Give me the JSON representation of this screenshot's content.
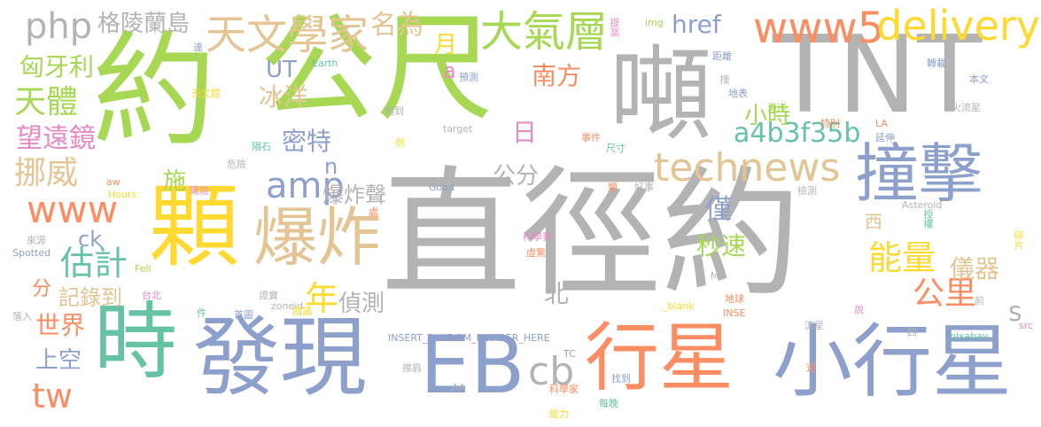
{
  "words": [
    {
      "text": "直徑約",
      "color": "#b3b3b3"
    },
    {
      "text": "公尺",
      "color": "#a6d854"
    },
    {
      "text": "約",
      "color": "#a6d854"
    },
    {
      "text": "TNT",
      "color": "#b3b3b3"
    },
    {
      "text": "噸",
      "color": "#b3b3b3"
    },
    {
      "text": "顆",
      "color": "#ffd92f"
    },
    {
      "text": "發現",
      "color": "#8da0cb"
    },
    {
      "text": "時",
      "color": "#66c2a5"
    },
    {
      "text": "行星",
      "color": "#fc8d62"
    },
    {
      "text": "小行星",
      "color": "#8da0cb"
    },
    {
      "text": "EB",
      "color": "#8da0cb"
    },
    {
      "text": "撞擊",
      "color": "#8da0cb"
    },
    {
      "text": "爆炸",
      "color": "#e5c494"
    },
    {
      "text": "天文學家",
      "color": "#e5c494"
    },
    {
      "text": "www5",
      "color": "#fc8d62"
    },
    {
      "text": "delivery",
      "color": "#ffd92f"
    },
    {
      "text": "大氣層",
      "color": "#a6d854"
    },
    {
      "text": "technews",
      "color": "#e5c494"
    },
    {
      "text": "php",
      "color": "#b3b3b3"
    },
    {
      "text": "格陵蘭島",
      "color": "#b3b3b3"
    },
    {
      "text": "名為",
      "color": "#e5c494"
    },
    {
      "text": "天體",
      "color": "#a6d854"
    },
    {
      "text": "匈牙利",
      "color": "#a6d854"
    },
    {
      "text": "望遠鏡",
      "color": "#e78ac3"
    },
    {
      "text": "挪威",
      "color": "#e5c494"
    },
    {
      "text": "www",
      "color": "#fc8d62"
    },
    {
      "text": "估計",
      "color": "#66c2a5"
    },
    {
      "text": "amp",
      "color": "#8da0cb"
    },
    {
      "text": "a4b3f35b",
      "color": "#66c2a5"
    },
    {
      "text": "能量",
      "color": "#ffd92f"
    },
    {
      "text": "公里",
      "color": "#fc8d62"
    },
    {
      "text": "cb",
      "color": "#b3b3b3"
    },
    {
      "text": "世界",
      "color": "#fc8d62"
    },
    {
      "text": "上空",
      "color": "#8da0cb"
    },
    {
      "text": "tw",
      "color": "#fc8d62"
    },
    {
      "text": "記錄到",
      "color": "#e5c494"
    },
    {
      "text": "年",
      "color": "#ffd92f"
    },
    {
      "text": "偵測",
      "color": "#b3b3b3"
    },
    {
      "text": "秒速",
      "color": "#a6d854"
    },
    {
      "text": "儀器",
      "color": "#e5c494"
    },
    {
      "text": "南方",
      "color": "#fc8d62"
    },
    {
      "text": "小時",
      "color": "#a6d854"
    },
    {
      "text": "href",
      "color": "#8da0cb"
    },
    {
      "text": "密特",
      "color": "#8da0cb"
    },
    {
      "text": "冰洋",
      "color": "#e5c494"
    },
    {
      "text": "UT",
      "color": "#8da0cb"
    },
    {
      "text": "爆炸聲",
      "color": "#b3b3b3"
    },
    {
      "text": "公分",
      "color": "#b3b3b3"
    },
    {
      "text": "施",
      "color": "#a6d854"
    },
    {
      "text": "僅",
      "color": "#8da0cb"
    },
    {
      "text": "ck",
      "color": "#8da0cb"
    },
    {
      "text": "分",
      "color": "#fc8d62"
    },
    {
      "text": "北",
      "color": "#b3b3b3"
    },
    {
      "text": "日",
      "color": "#e78ac3"
    },
    {
      "text": "月",
      "color": "#ffd92f"
    },
    {
      "text": "a",
      "color": "#e78ac3"
    },
    {
      "text": "n",
      "color": "#8da0cb"
    },
    {
      "text": "s",
      "color": "#b3b3b3"
    },
    {
      "text": "西",
      "color": "#e5c494"
    },
    {
      "text": "img",
      "color": "#a6d854"
    },
    {
      "text": "提高",
      "color": "#e78ac3"
    },
    {
      "text": "達",
      "color": "#8da0cb"
    },
    {
      "text": "Earth",
      "color": "#66c2a5"
    },
    {
      "text": "預測",
      "color": "#8da0cb"
    },
    {
      "text": "天文館",
      "color": "#ffd92f"
    },
    {
      "text": "落到",
      "color": "#b3b3b3"
    },
    {
      "text": "target",
      "color": "#b3b3b3"
    },
    {
      "text": "隕石",
      "color": "#66c2a5"
    },
    {
      "text": "危險",
      "color": "#b3b3b3"
    },
    {
      "text": "例",
      "color": "#ffd92f"
    },
    {
      "text": "事件",
      "color": "#fc8d62"
    },
    {
      "text": "尺寸",
      "color": "#66c2a5"
    },
    {
      "text": "距離",
      "color": "#8da0cb"
    },
    {
      "text": "撞",
      "color": "#b3b3b3"
    },
    {
      "text": "地表",
      "color": "#8da0cb"
    },
    {
      "text": "海洋",
      "color": "#a6d854"
    },
    {
      "text": "轉載",
      "color": "#8da0cb"
    },
    {
      "text": "本文",
      "color": "#8da0cb"
    },
    {
      "text": "火流星",
      "color": "#b3b3b3"
    },
    {
      "text": "特別",
      "color": "#fc8d62"
    },
    {
      "text": "LA",
      "color": "#fc8d62"
    },
    {
      "text": "延伸",
      "color": "#8da0cb"
    },
    {
      "text": "aw",
      "color": "#fc8d62"
    },
    {
      "text": "Hours",
      "color": "#ffd92f"
    },
    {
      "text": "驚險",
      "color": "#e78ac3"
    },
    {
      "text": "Good",
      "color": "#8da0cb"
    },
    {
      "text": "處",
      "color": "#fc8d62"
    },
    {
      "text": "類",
      "color": "#fc8d62"
    },
    {
      "text": "好事",
      "color": "#b3b3b3"
    },
    {
      "text": "檢測",
      "color": "#b3b3b3"
    },
    {
      "text": "Asteroid",
      "color": "#b3b3b3"
    },
    {
      "text": "授權",
      "color": "#66c2a5"
    },
    {
      "text": "碎片",
      "color": "#ffd92f"
    },
    {
      "text": "來源",
      "color": "#b3b3b3"
    },
    {
      "text": "Spotted",
      "color": "#8da0cb"
    },
    {
      "text": "Fell",
      "color": "#a6d854"
    },
    {
      "text": "科學界",
      "color": "#e78ac3"
    },
    {
      "text": "虛驚",
      "color": "#fc8d62"
    },
    {
      "text": "MO",
      "color": "#b3b3b3"
    },
    {
      "text": "台北",
      "color": "#e78ac3"
    },
    {
      "text": "證實",
      "color": "#b3b3b3"
    },
    {
      "text": "zoneid",
      "color": "#b3b3b3"
    },
    {
      "text": "_blank",
      "color": "#ffd92f"
    },
    {
      "text": "地球",
      "color": "#fc8d62"
    },
    {
      "text": "INSE",
      "color": "#fc8d62"
    },
    {
      "text": "說",
      "color": "#e78ac3"
    },
    {
      "text": "前",
      "color": "#b3b3b3"
    },
    {
      "text": "件",
      "color": "#66c2a5"
    },
    {
      "text": "首圖",
      "color": "#8da0cb"
    },
    {
      "text": "閱讀",
      "color": "#ffd92f"
    },
    {
      "text": "落入",
      "color": "#b3b3b3"
    },
    {
      "text": "INSERT_RANDOM_NUMBER_HERE",
      "color": "#8da0cb"
    },
    {
      "text": "流星",
      "color": "#b3b3b3"
    },
    {
      "text": "四",
      "color": "#b3b3b3"
    },
    {
      "text": "pixabay",
      "color": "#66c2a5"
    },
    {
      "text": "src",
      "color": "#e78ac3"
    },
    {
      "text": "TC",
      "color": "#8da0cb"
    },
    {
      "text": "擦肩",
      "color": "#b3b3b3"
    },
    {
      "text": "逐",
      "color": "#fc8d62"
    },
    {
      "text": "AA",
      "color": "#b3b3b3"
    },
    {
      "text": "找到",
      "color": "#8da0cb"
    },
    {
      "text": "科學家",
      "color": "#fc8d62"
    },
    {
      "text": "每晚",
      "color": "#66c2a5"
    },
    {
      "text": "能力",
      "color": "#ffd92f"
    }
  ]
}
